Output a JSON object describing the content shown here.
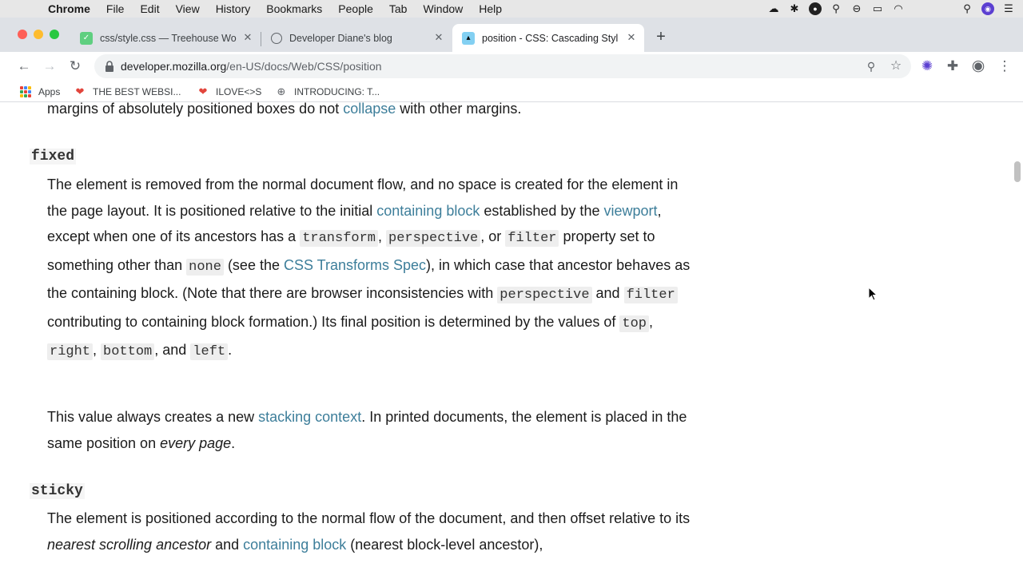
{
  "menubar": {
    "app": "Chrome",
    "items": [
      "File",
      "Edit",
      "View",
      "History",
      "Bookmarks",
      "People",
      "Tab",
      "Window",
      "Help"
    ]
  },
  "tabs": [
    {
      "title": "css/style.css — Treehouse Wo",
      "icon": "treehouse-icon"
    },
    {
      "title": "Developer Diane's blog",
      "icon": "globe-icon"
    },
    {
      "title": "position - CSS: Cascading Styl",
      "icon": "mdn-icon",
      "active": true
    }
  ],
  "address": {
    "domain": "developer.mozilla.org",
    "path": "/en-US/docs/Web/CSS/position"
  },
  "bookmarks": [
    {
      "label": "Apps",
      "icon": "apps-grid-icon"
    },
    {
      "label": "THE BEST WEBSI...",
      "icon": "heart-eyes-icon"
    },
    {
      "label": "ILOVE<>S",
      "icon": "heart-eyes-icon"
    },
    {
      "label": "INTRODUCING: T...",
      "icon": "globe-icon"
    }
  ],
  "article": {
    "absolute_tail": {
      "t1": "margins of absolutely positioned boxes do not ",
      "link": "collapse",
      "t2": " with other margins."
    },
    "fixed": {
      "term": "fixed",
      "p1": {
        "t1": "The element is removed from the normal document flow, and no space is created for the element in the page layout. It is positioned relative to the initial ",
        "link1": "containing block",
        "t2": " established by the ",
        "link2": "viewport",
        "t3": ", except when one of its ancestors has a ",
        "c1": "transform",
        "t4": ", ",
        "c2": "perspective",
        "t5": ", or ",
        "c3": "filter",
        "t6": " property set to something other than ",
        "c4": "none",
        "t7": " (see the ",
        "link3": "CSS Transforms Spec",
        "t8": "), in which case that ancestor behaves as the containing block. (Note that there are browser inconsistencies with ",
        "c5": "perspective",
        "t9": " and ",
        "c6": "filter",
        "t10": " contributing to containing block formation.) Its final position is determined by the values of ",
        "c7": "top",
        "t11": ", ",
        "c8": "right",
        "t12": ", ",
        "c9": "bottom",
        "t13": ", and ",
        "c10": "left",
        "t14": "."
      },
      "p2": {
        "t1": "This value always creates a new ",
        "link": "stacking context",
        "t2": ". In printed documents, the element is placed in the same position on ",
        "em": "every page",
        "t3": "."
      }
    },
    "sticky": {
      "term": "sticky",
      "p1": {
        "t1": "The element is positioned according to the normal flow of the document, and then offset relative to its ",
        "em": "nearest scrolling ancestor",
        "t2": " and ",
        "link": "containing block",
        "t3": " (nearest block-level ancestor),"
      }
    }
  },
  "colors": {
    "link": "#3d7e9a",
    "tabstrip": "#dee1e6",
    "menubar": "#e7e7e7"
  }
}
